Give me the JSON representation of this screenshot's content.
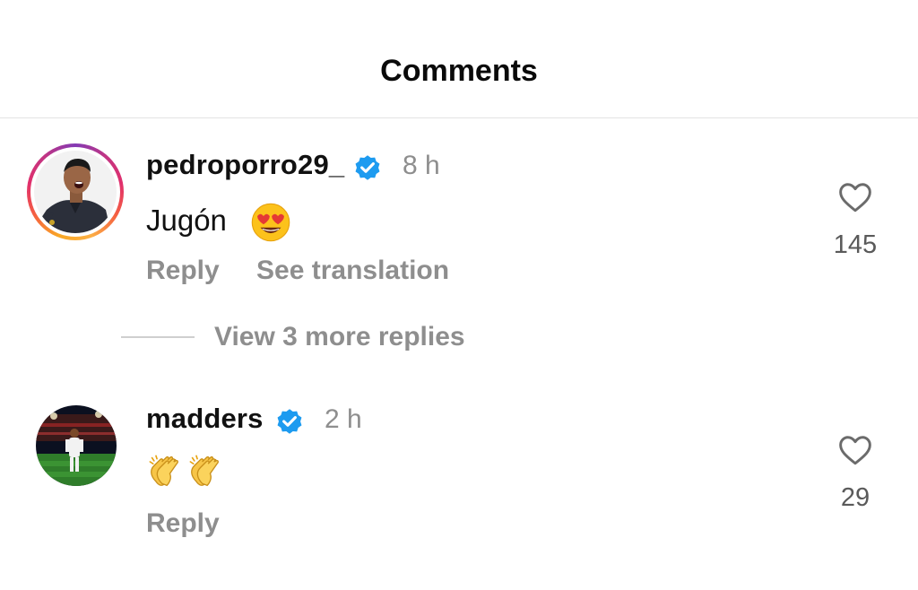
{
  "header": {
    "title": "Comments"
  },
  "comments": [
    {
      "username": "pedroporro29_",
      "time": "8 h",
      "text": "Jugón",
      "emoji": "smiling-face-with-heart-eyes",
      "actions": {
        "reply": "Reply",
        "translate": "See translation"
      },
      "likes": "145",
      "has_story_ring": true,
      "verified": true
    },
    {
      "username": "madders",
      "time": "2 h",
      "text": "",
      "emoji": "clapping-hands x2",
      "actions": {
        "reply": "Reply"
      },
      "likes": "29",
      "has_story_ring": false,
      "verified": true
    }
  ],
  "replies": {
    "view_more": "View 3 more replies"
  },
  "colors": {
    "verified_blue": "#1d9bf0",
    "muted_text": "#8e8e8e",
    "divider": "#e4e4e4"
  }
}
